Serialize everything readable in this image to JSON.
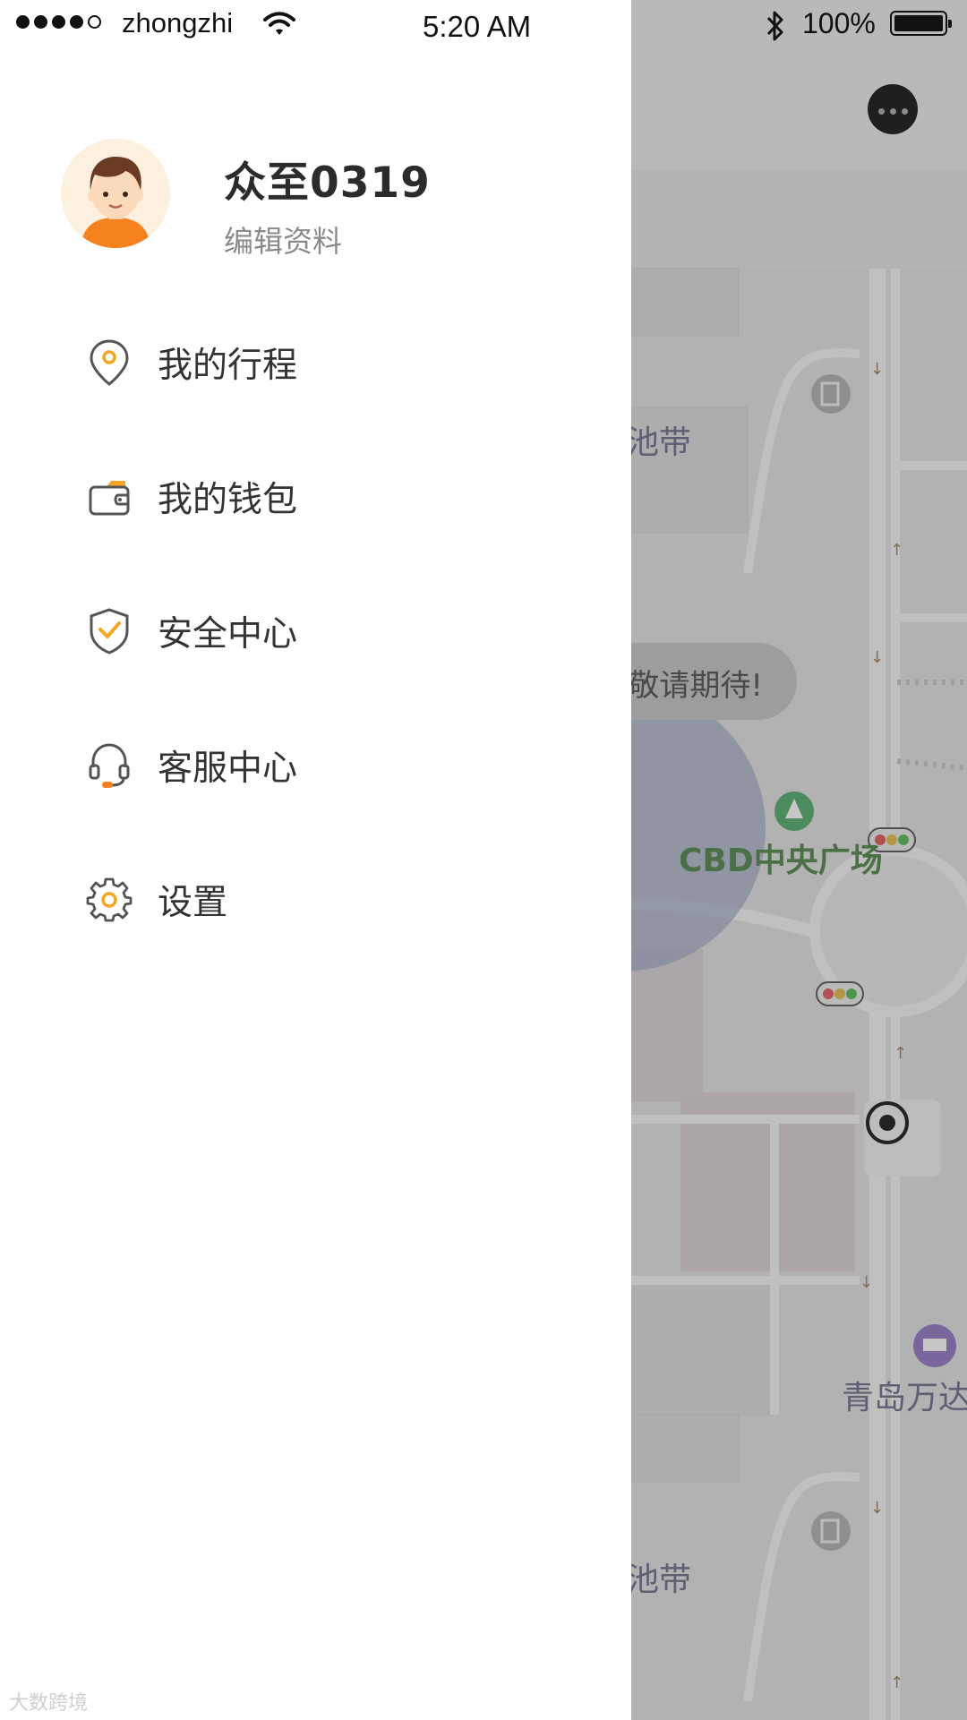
{
  "status_bar": {
    "carrier": "zhongzhi",
    "time": "5:20 AM",
    "battery": "100%"
  },
  "profile": {
    "username": "众至0319",
    "edit_label": "编辑资料"
  },
  "menu": {
    "items": [
      {
        "label": "我的行程",
        "icon": "location-pin-icon"
      },
      {
        "label": "我的钱包",
        "icon": "wallet-icon"
      },
      {
        "label": "安全中心",
        "icon": "shield-check-icon"
      },
      {
        "label": "客服中心",
        "icon": "headset-icon"
      },
      {
        "label": "设置",
        "icon": "gear-icon"
      }
    ]
  },
  "map": {
    "bubble_text": "敬请期待!",
    "poi_cbd": "CBD中央广场",
    "poi_belt_top": "池带",
    "poi_belt_bottom": "池带",
    "poi_qingdao": "青岛万达"
  },
  "watermark": "大数跨境",
  "colors": {
    "accent": "#f5a623",
    "icon_stroke": "#555555",
    "text_primary": "#333333",
    "text_secondary": "#8a8a8a"
  }
}
